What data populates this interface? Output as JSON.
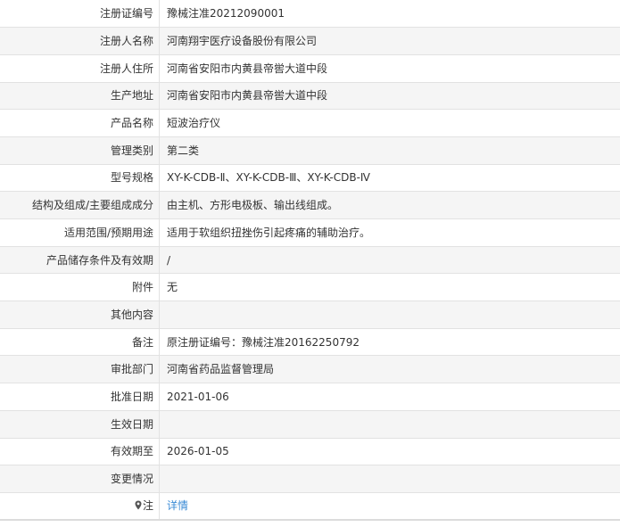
{
  "rows": [
    {
      "label": "注册证编号",
      "value": "豫械注准20212090001"
    },
    {
      "label": "注册人名称",
      "value": "河南翔宇医疗设备股份有限公司"
    },
    {
      "label": "注册人住所",
      "value": "河南省安阳市内黄县帝喾大道中段"
    },
    {
      "label": "生产地址",
      "value": "河南省安阳市内黄县帝喾大道中段"
    },
    {
      "label": "产品名称",
      "value": "短波治疗仪"
    },
    {
      "label": "管理类别",
      "value": "第二类"
    },
    {
      "label": "型号规格",
      "value": "XY-K-CDB-Ⅱ、XY-K-CDB-Ⅲ、XY-K-CDB-Ⅳ"
    },
    {
      "label": "结构及组成/主要组成成分",
      "value": "由主机、方形电极板、输出线组成。"
    },
    {
      "label": "适用范围/预期用途",
      "value": "适用于软组织扭挫伤引起疼痛的辅助治疗。"
    },
    {
      "label": "产品储存条件及有效期",
      "value": "/"
    },
    {
      "label": "附件",
      "value": "无"
    },
    {
      "label": "其他内容",
      "value": ""
    },
    {
      "label": "备注",
      "value": "原注册证编号：豫械注准20162250792"
    },
    {
      "label": "审批部门",
      "value": "河南省药品监督管理局"
    },
    {
      "label": "批准日期",
      "value": "2021-01-06"
    },
    {
      "label": "生效日期",
      "value": ""
    },
    {
      "label": "有效期至",
      "value": "2026-01-05"
    },
    {
      "label": "变更情况",
      "value": ""
    }
  ],
  "note_row": {
    "label": "注",
    "icon": "location-pin-icon",
    "link_text": "详情"
  },
  "colors": {
    "link": "#3a8bd6",
    "border": "#e2e2e2",
    "stripe": "#f5f5f5"
  }
}
